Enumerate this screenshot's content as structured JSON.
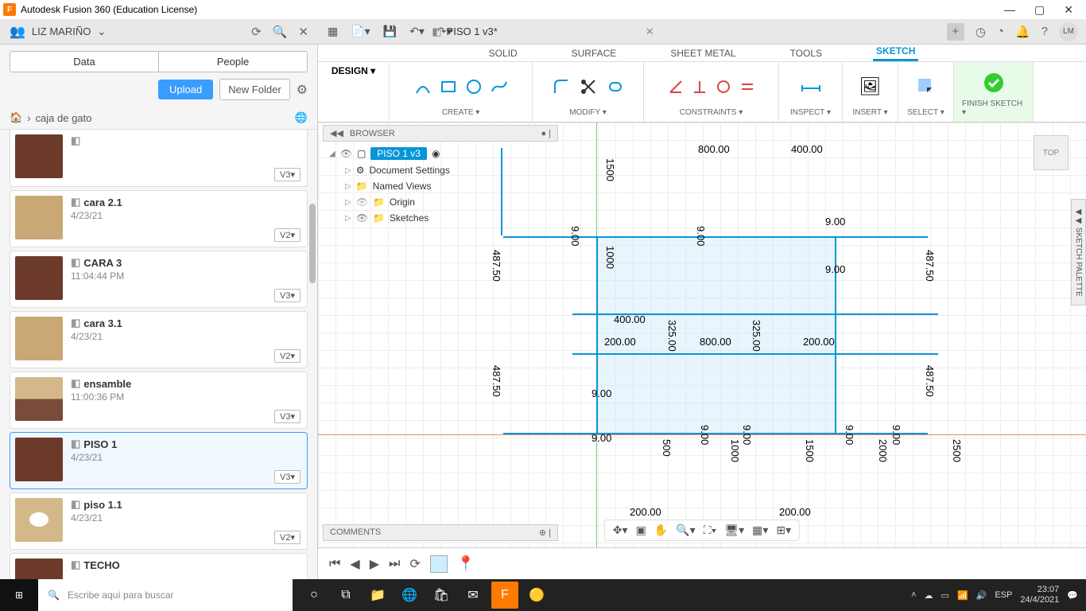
{
  "titlebar": {
    "app": "Autodesk Fusion 360 (Education License)"
  },
  "user": {
    "name": "LIZ MARIÑO",
    "badge": "LM"
  },
  "doc_tab": {
    "title": "PISO 1 v3*"
  },
  "left": {
    "tabs": {
      "data": "Data",
      "people": "People"
    },
    "upload": "Upload",
    "newfolder": "New Folder",
    "breadcrumb": "caja de gato",
    "items": [
      {
        "name": "",
        "date": "",
        "ver": "V3▾",
        "cls": "dark",
        "half": true
      },
      {
        "name": "cara 2.1",
        "date": "4/23/21",
        "ver": "V2▾",
        "cls": ""
      },
      {
        "name": "CARA 3",
        "date": "11:04:44 PM",
        "ver": "V3▾",
        "cls": "dark"
      },
      {
        "name": "cara 3.1",
        "date": "4/23/21",
        "ver": "V2▾",
        "cls": ""
      },
      {
        "name": "ensamble",
        "date": "11:00:36 PM",
        "ver": "V3▾",
        "cls": "ensam"
      },
      {
        "name": "PISO 1",
        "date": "4/23/21",
        "ver": "V3▾",
        "cls": "dark",
        "sel": true
      },
      {
        "name": "piso 1.1",
        "date": "4/23/21",
        "ver": "V2▾",
        "cls": "hole"
      },
      {
        "name": "TECHO",
        "date": "",
        "ver": "",
        "cls": "dark",
        "half2": true
      }
    ]
  },
  "ribbon": {
    "tabs": [
      "SOLID",
      "SURFACE",
      "SHEET METAL",
      "TOOLS",
      "SKETCH"
    ],
    "active": 4,
    "design": "DESIGN ▾",
    "groups": {
      "create": "CREATE ▾",
      "modify": "MODIFY ▾",
      "constraints": "CONSTRAINTS ▾",
      "inspect": "INSPECT ▾",
      "insert": "INSERT ▾",
      "select": "SELECT ▾",
      "finish": "FINISH SKETCH ▾"
    }
  },
  "browser": {
    "title": "BROWSER",
    "root": "PISO 1 v3",
    "nodes": [
      "Document Settings",
      "Named Views",
      "Origin",
      "Sketches"
    ]
  },
  "viewcube": "TOP",
  "palette": "SKETCH PALETTE",
  "comments": "COMMENTS",
  "dims": {
    "d800a": "800.00",
    "d400a": "400.00",
    "d1500v": "1500",
    "d1000v": "1000",
    "d325v": "325.00",
    "d325v2": "325.00",
    "d9a": "9.00",
    "d9b": "9.00",
    "d9c": "9.00",
    "d9d": "9.00",
    "d9e": "9.00",
    "d9f": "9.00",
    "d9g": "9.00",
    "d9h": "9.00",
    "d9i": "9.00",
    "d9j": "9.00",
    "d48750a": "487.50",
    "d48750b": "487.50",
    "d48750c": "487.50",
    "d48750d": "487.50",
    "d400b": "400.00",
    "d200a": "200.00",
    "d800b": "800.00",
    "d200b": "200.00",
    "d1500v2": "1500",
    "d500v": "500",
    "d1000v2": "1000",
    "d2000v": "2000",
    "d2500v": "2500",
    "d200c": "200.00",
    "d200d": "200.00"
  },
  "taskbar": {
    "search": "Escribe aquí para buscar",
    "lang": "ESP",
    "time": "23:07",
    "date": "24/4/2021"
  }
}
